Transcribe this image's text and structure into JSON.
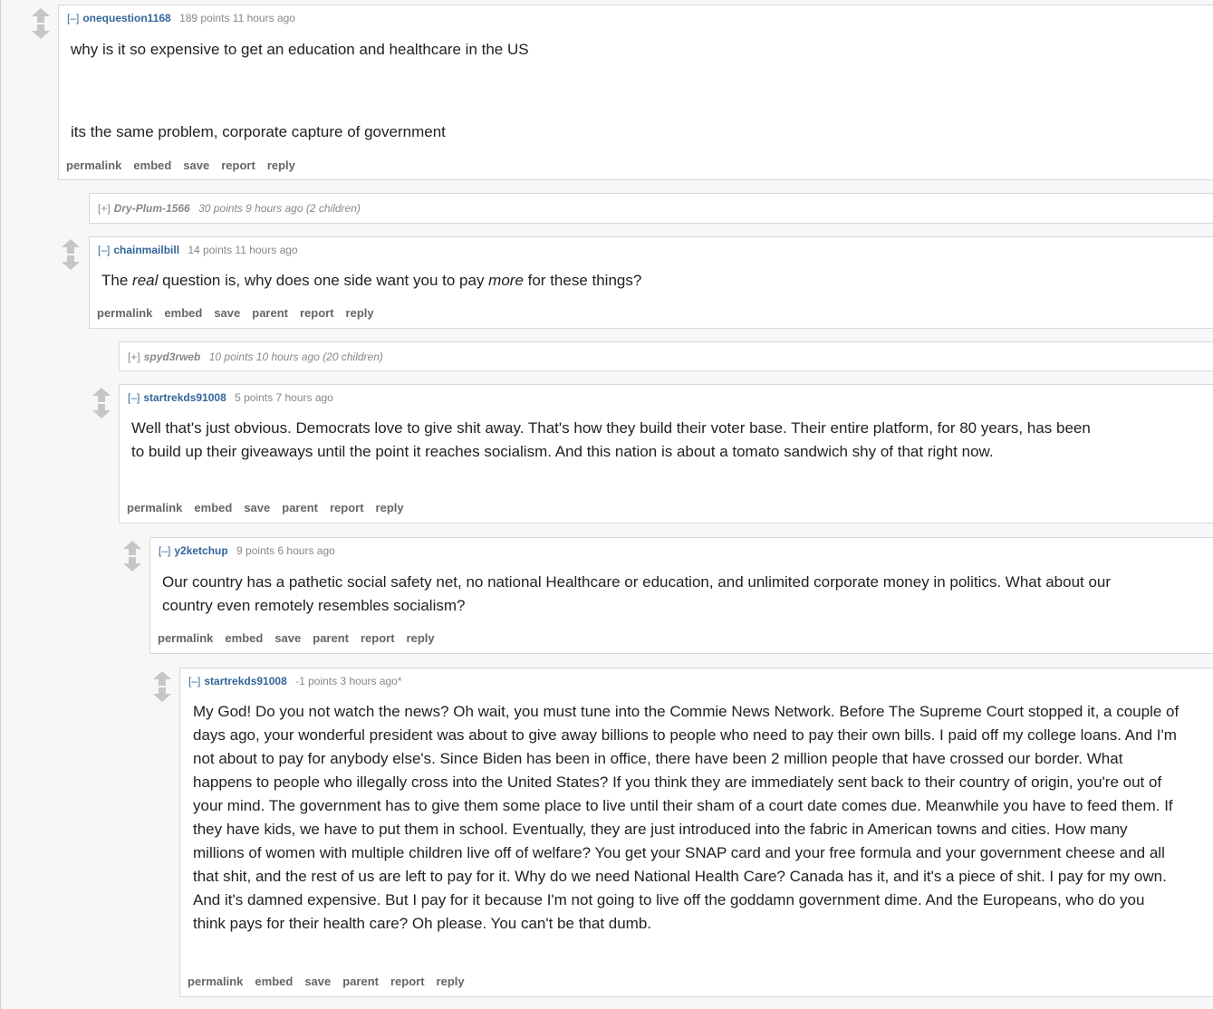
{
  "colors": {
    "link": "#336699",
    "meta": "#888888",
    "arrow": "#c6c6c6",
    "button": "#666666"
  },
  "icons": {
    "up": "upvote-arrow-icon",
    "down": "downvote-arrow-icon"
  },
  "comments": [
    {
      "toggle": "[–]",
      "author": "onequestion1168",
      "score": "189 points",
      "time": "11 hours ago",
      "paragraphs": [
        "why is it so expensive to get an education and healthcare in the US",
        "its the same problem, corporate capture of government"
      ],
      "buttons": [
        "permalink",
        "embed",
        "save",
        "report",
        "reply"
      ]
    },
    {
      "toggle": "[+]",
      "author": "Dry-Plum-1566",
      "score": "30 points",
      "time": "9 hours ago",
      "children": "(2 children)"
    },
    {
      "toggle": "[–]",
      "author": "chainmailbill",
      "score": "14 points",
      "time": "11 hours ago",
      "text": {
        "a": "The ",
        "b": "real",
        "c": " question is, why does one side want you to pay ",
        "d": "more",
        "e": " for these things?"
      },
      "buttons": [
        "permalink",
        "embed",
        "save",
        "parent",
        "report",
        "reply"
      ]
    },
    {
      "toggle": "[+]",
      "author": "spyd3rweb",
      "score": "10 points",
      "time": "10 hours ago",
      "children": "(20 children)"
    },
    {
      "toggle": "[–]",
      "author": "startrekds91008",
      "score": "5 points",
      "time": "7 hours ago",
      "paragraphs": [
        "Well that's just obvious. Democrats love to give shit away. That's how they build their voter base. Their entire platform, for 80 years, has been to build up their giveaways until the point it reaches socialism. And this nation is about a tomato sandwich shy of that right now."
      ],
      "buttons": [
        "permalink",
        "embed",
        "save",
        "parent",
        "report",
        "reply"
      ]
    },
    {
      "toggle": "[–]",
      "author": "y2ketchup",
      "score": "9 points",
      "time": "6 hours ago",
      "paragraphs": [
        "Our country has a pathetic social safety net, no national Healthcare or education, and unlimited corporate money in politics. What about our country even remotely resembles socialism?"
      ],
      "buttons": [
        "permalink",
        "embed",
        "save",
        "parent",
        "report",
        "reply"
      ]
    },
    {
      "toggle": "[–]",
      "author": "startrekds91008",
      "score": "-1 points",
      "time": "3 hours ago*",
      "paragraphs": [
        "My God! Do you not watch the news? Oh wait, you must tune into the Commie News Network. Before The Supreme Court stopped it, a couple of days ago, your wonderful president was about to give away billions to people who need to pay their own bills. I paid off my college loans. And I'm not about to pay for anybody else's. Since Biden has been in office, there have been 2 million people that have crossed our border. What happens to people who illegally cross into the United States? If you think they are immediately sent back to their country of origin, you're out of your mind. The government has to give them some place to live until their sham of a court date comes due. Meanwhile you have to feed them. If they have kids, we have to put them in school. Eventually, they are just introduced into the fabric in American towns and cities. How many millions of women with multiple children live off of welfare? You get your SNAP card and your free formula and your government cheese and all that shit, and the rest of us are left to pay for it. Why do we need National Health Care? Canada has it, and it's a piece of shit. I pay for my own. And it's damned expensive. But I pay for it because I'm not going to live off the goddamn government dime. And the Europeans, who do you think pays for their health care? Oh please. You can't be that dumb."
      ],
      "buttons": [
        "permalink",
        "embed",
        "save",
        "parent",
        "report",
        "reply"
      ]
    }
  ]
}
